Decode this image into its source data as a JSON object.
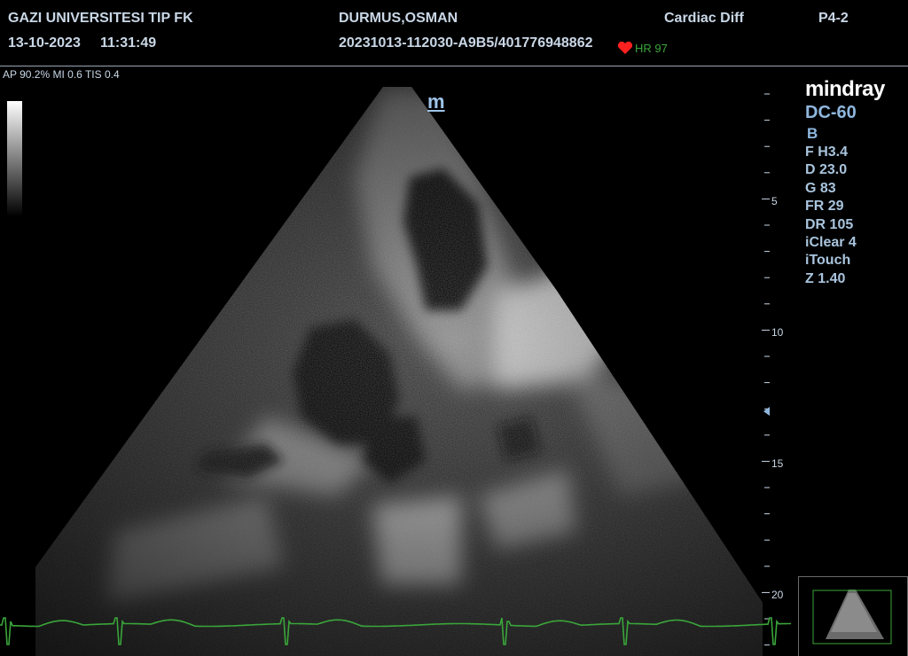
{
  "header": {
    "institution": "GAZI UNIVERSITESI TIP FK",
    "date": "13-10-2023",
    "time": "11:31:49",
    "patient_name": "DURMUS,OSMAN",
    "study_id": "20231013-112030-A9B5/401776948862",
    "exam_preset": "Cardiac Diff",
    "probe": "P4-2",
    "heart_rate_label": "HR",
    "heart_rate_value": "97"
  },
  "acoustic_output": "AP 90.2%  MI 0.6 TIS 0.4",
  "orientation_marker": "m",
  "system": {
    "brand": "mindray",
    "model": "DC-60"
  },
  "imaging_params": {
    "mode": "B",
    "items": [
      "F H3.4",
      "D 23.0",
      "G 83",
      "FR 29",
      "DR 105",
      "iClear 4",
      "iTouch",
      "Z 1.40"
    ]
  },
  "depth_scale": {
    "labels": [
      "5",
      "10",
      "15",
      "20"
    ]
  },
  "colors": {
    "text": "#c9d7e6",
    "param_text": "#a9c4dd",
    "ecg_trace": "#3aa63a",
    "heart_icon": "#ff2020",
    "hr_text": "#3aa63a"
  },
  "icons": {
    "heart": "heart-icon",
    "focus": "focus-marker-icon"
  }
}
